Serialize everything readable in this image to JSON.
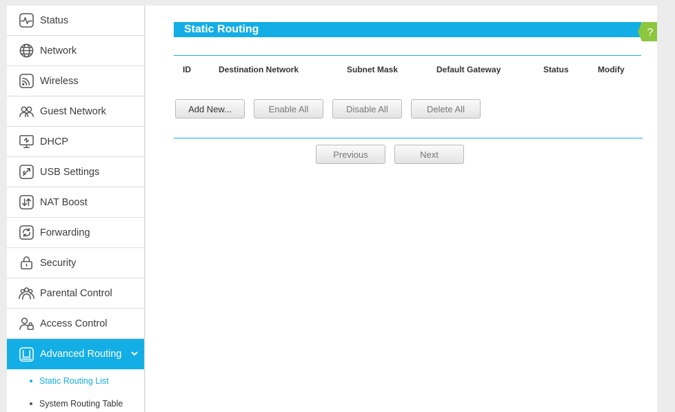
{
  "sidebar": {
    "items": [
      {
        "label": "Status",
        "icon": "status-icon"
      },
      {
        "label": "Network",
        "icon": "globe-icon"
      },
      {
        "label": "Wireless",
        "icon": "wifi-icon"
      },
      {
        "label": "Guest Network",
        "icon": "guests-icon"
      },
      {
        "label": "DHCP",
        "icon": "monitor-icon"
      },
      {
        "label": "USB Settings",
        "icon": "usb-icon"
      },
      {
        "label": "NAT Boost",
        "icon": "arrows-icon"
      },
      {
        "label": "Forwarding",
        "icon": "refresh-icon"
      },
      {
        "label": "Security",
        "icon": "lock-icon"
      },
      {
        "label": "Parental Control",
        "icon": "family-icon"
      },
      {
        "label": "Access Control",
        "icon": "user-lock-icon"
      },
      {
        "label": "Advanced Routing",
        "icon": "router-icon",
        "active": true
      }
    ],
    "subitems": [
      {
        "label": "Static Routing List",
        "active": true
      },
      {
        "label": "System Routing Table",
        "active": false
      }
    ]
  },
  "main": {
    "title": "Static Routing",
    "help_label": "?",
    "columns": [
      "ID",
      "Destination Network",
      "Subnet Mask",
      "Default Gateway",
      "Status",
      "Modify"
    ],
    "buttons": {
      "add_new": "Add New...",
      "enable_all": "Enable All",
      "disable_all": "Disable All",
      "delete_all": "Delete All"
    },
    "pager": {
      "previous": "Previous",
      "next": "Next"
    }
  },
  "colors": {
    "accent": "#13aee5",
    "help": "#8cc63f"
  }
}
